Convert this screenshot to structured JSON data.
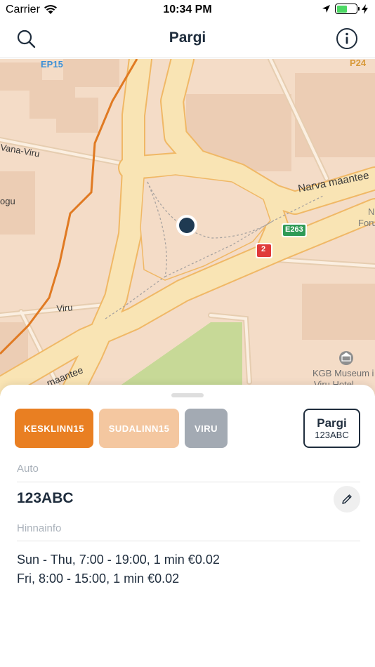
{
  "status_bar": {
    "carrier": "Carrier",
    "time": "10:34 PM",
    "battery_level": 0.55
  },
  "nav": {
    "title": "Pargi",
    "search_icon": "search-icon",
    "info_icon": "info-icon"
  },
  "map": {
    "labels": {
      "ep15": "EP15",
      "p24": "P24",
      "vana_viru": "Vana-Viru",
      "narva_maantee": "Narva maantee",
      "e263": "E263",
      "route_2": "2",
      "ogu": "ogu",
      "viru": "Viru",
      "maantee": "maantee",
      "n": "N",
      "foru": "Foru",
      "kgb_museum": "KGB Museum i",
      "viru_hotel": "Viru Hotel"
    },
    "colors": {
      "land": "#f4dcc7",
      "road": "#f9e4b4",
      "road_border": "#f0b866",
      "park": "#c7d997",
      "boundary": "#e07a22",
      "location_dot": "#1f3a52"
    }
  },
  "zones": [
    {
      "label": "KESKLINN15",
      "color": "#e97f22"
    },
    {
      "label": "SUDALINN15",
      "color": "#f4c7a0"
    },
    {
      "label": "VIRU",
      "color": "#a3aab3"
    }
  ],
  "park_button": {
    "title": "Pargi",
    "plate": "123ABC"
  },
  "car": {
    "section_label": "Auto",
    "plate": "123ABC",
    "edit_icon": "pencil-icon"
  },
  "pricing": {
    "section_label": "Hinnainfo",
    "lines": [
      "Sun - Thu, 7:00 - 19:00, 1 min €0.02",
      "Fri, 8:00 - 15:00, 1 min €0.02"
    ]
  }
}
